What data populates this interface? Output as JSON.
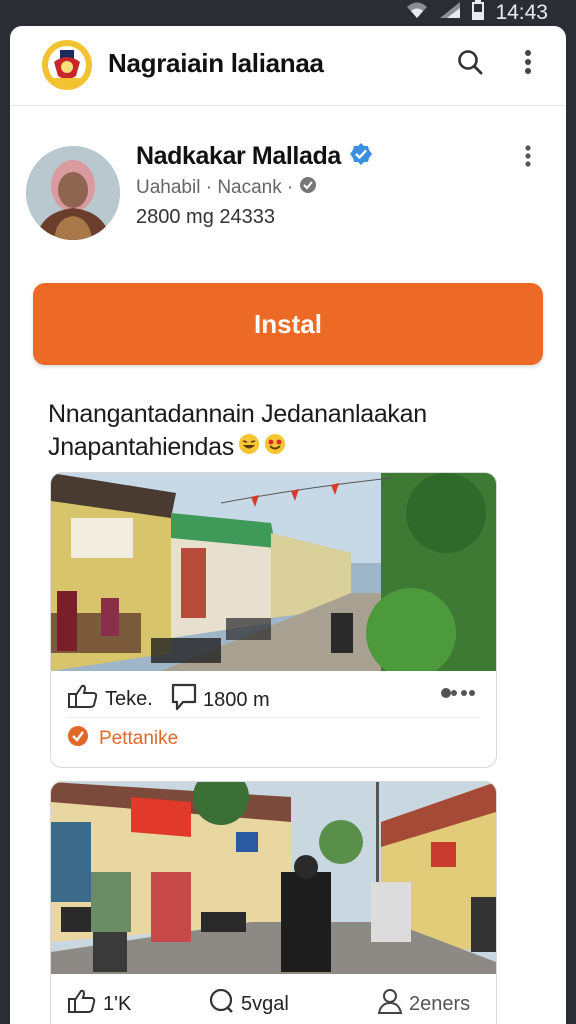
{
  "status": {
    "time": "14:43"
  },
  "app": {
    "title": "Nagraiain lalianaa"
  },
  "profile": {
    "name": "Nadkakar Mallada",
    "subtitle": "Uahabil · Nacank ·",
    "stats": "2800 mg  24333"
  },
  "install_label": "Instal",
  "caption_line1": "Nnangantadannain Jedananlaakan",
  "caption_line2": "Jnapantahiendas",
  "post1": {
    "like_label": "Teke.",
    "comment_label": "1800 m",
    "tag_label": "Pettanike"
  },
  "post2": {
    "like_label": "1'K",
    "comment_label": "5vgal",
    "share_label": "2eners"
  },
  "colors": {
    "accent": "#ec6a25",
    "verified": "#3b8fe0"
  },
  "icons": [
    "wifi-icon",
    "signal-icon",
    "battery-icon",
    "search-icon",
    "more-vert-icon",
    "verified-icon",
    "thumb-up-icon",
    "comment-icon",
    "more-horiz-icon",
    "check-circle-icon",
    "share-icon"
  ]
}
